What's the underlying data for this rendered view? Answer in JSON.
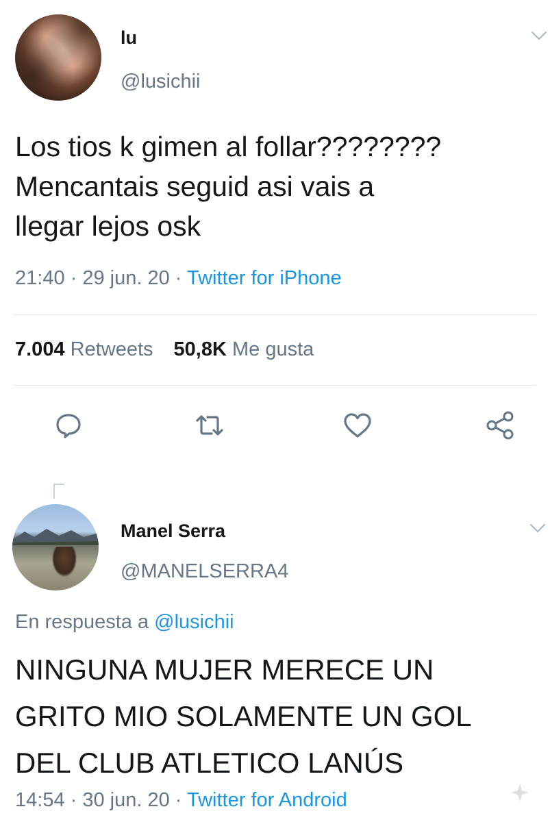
{
  "tweet1": {
    "name": "lu",
    "handle": "@lusichii",
    "text": "Los tios k gimen al follar????????\nMencantais seguid asi vais a\nllegar lejos osk",
    "time": "21:40 · 29 jun. 20 · ",
    "source": "Twitter for iPhone",
    "retweets_count": "7.004",
    "retweets_label": "Retweets",
    "likes_count": "50,8K",
    "likes_label": "Me gusta",
    "icons": [
      "reply-icon",
      "retweet-icon",
      "like-icon",
      "share-icon",
      "chevron-down-icon"
    ]
  },
  "tweet2": {
    "name": "Manel Serra",
    "handle": "@MANELSERRA4",
    "reply_prefix": "En respuesta a ",
    "reply_handle": "@lusichii",
    "text": "NINGUNA MUJER MERECE UN\nGRITO MIO SOLAMENTE UN GOL\nDEL CLUB ATLETICO LANÚS",
    "time": "14:54 · 30 jun. 20 · ",
    "source": "Twitter for Android",
    "icons": [
      "chevron-down-icon"
    ]
  },
  "colors": {
    "text": "#14171a",
    "muted": "#657786",
    "link": "#1b95e0",
    "divider": "#e1e8ed"
  }
}
